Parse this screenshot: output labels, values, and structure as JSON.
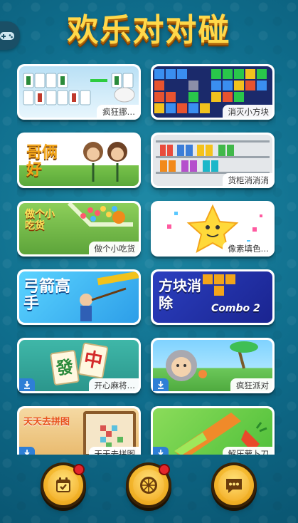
{
  "header": {
    "title": "欢乐对对碰"
  },
  "games": [
    {
      "label": "疯狂挪…",
      "download": false
    },
    {
      "label": "消灭小方块",
      "download": false
    },
    {
      "label": "",
      "art_text": "哥俩好",
      "download": false
    },
    {
      "label": "货柜消消消",
      "download": false
    },
    {
      "label": "做个小吃货",
      "art_text": "做个小吃货",
      "download": false
    },
    {
      "label": "像素填色…",
      "download": false
    },
    {
      "label": "",
      "art_text": "弓箭高手",
      "download": false
    },
    {
      "label": "",
      "art_text": "方块消除",
      "art_badge": "Combo 2",
      "download": false
    },
    {
      "label": "开心麻将…",
      "art_tiles": [
        "中",
        "發"
      ],
      "download": true
    },
    {
      "label": "疯狂派对",
      "download": true
    },
    {
      "label": "天天去拼图",
      "art_text": "天天去拼图",
      "download": true
    },
    {
      "label": "解压萝卜刀",
      "download": true
    }
  ],
  "bottom_nav": [
    {
      "name": "calendar",
      "has_badge": true
    },
    {
      "name": "wheel",
      "has_badge": true
    },
    {
      "name": "message",
      "has_badge": false
    }
  ],
  "colors": {
    "title": "#ffd84a",
    "badge": "#e5252a",
    "download": "#2e7fd6"
  }
}
